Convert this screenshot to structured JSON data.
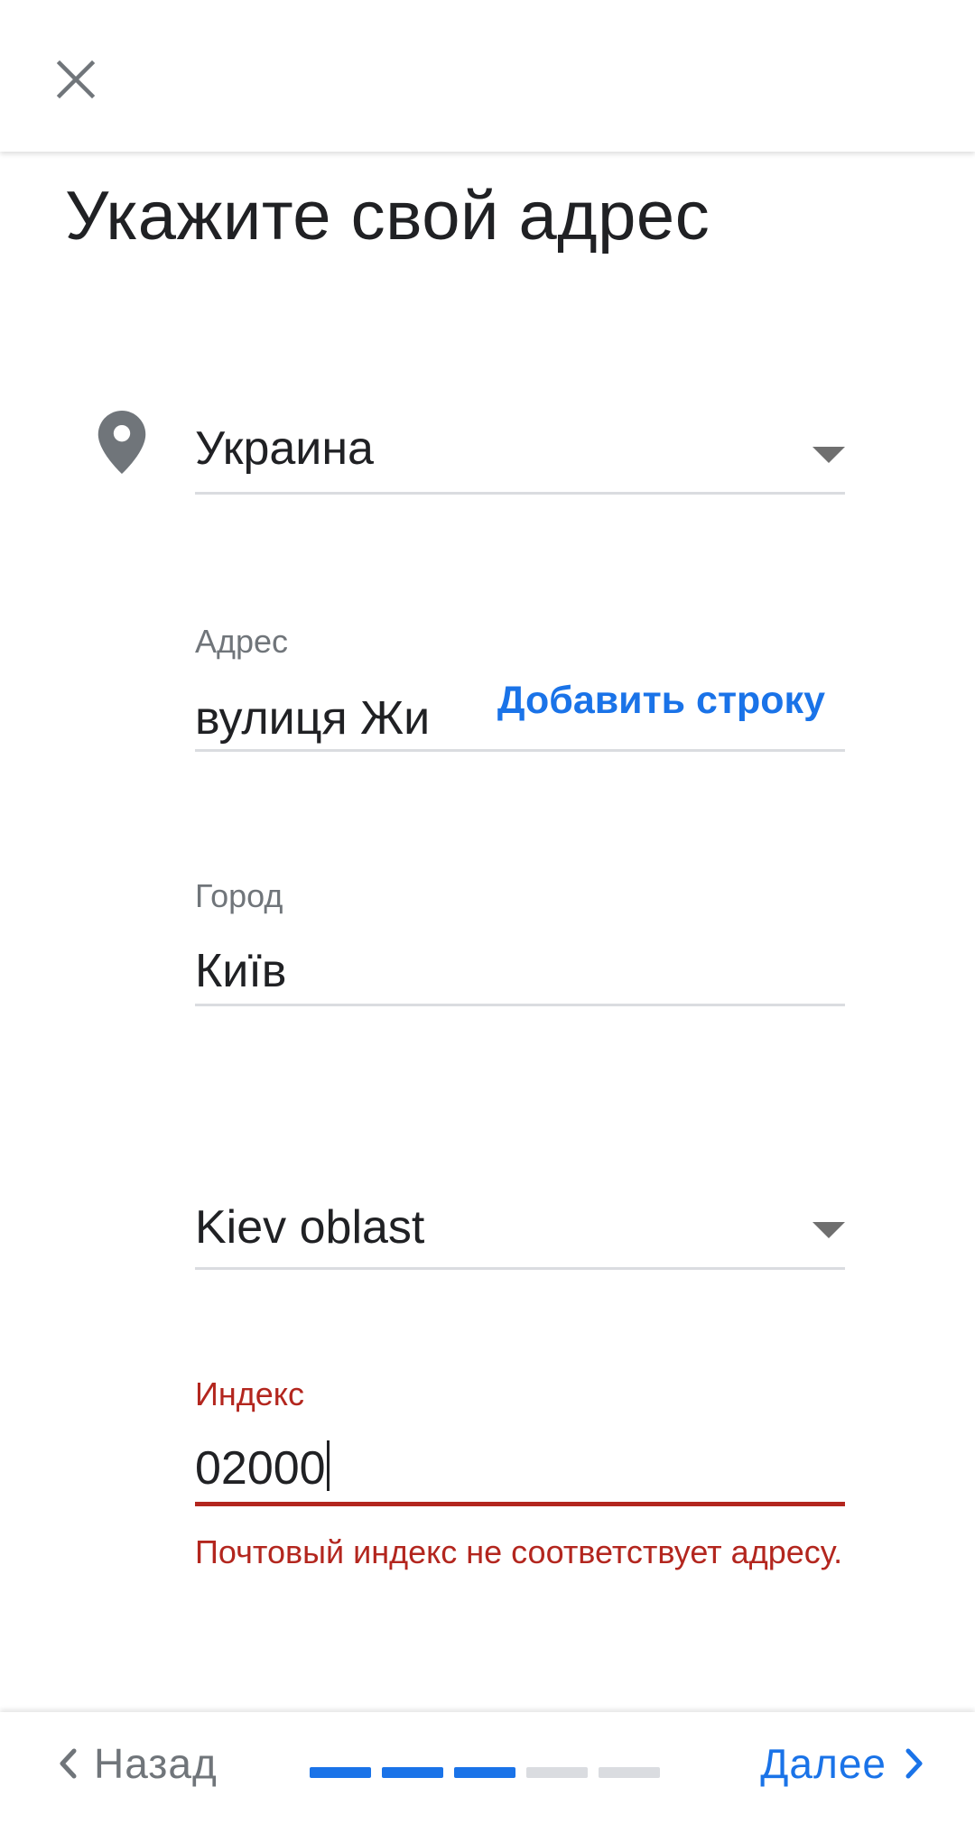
{
  "header": {
    "close_icon": "close-icon"
  },
  "page": {
    "title": "Укажите свой адрес"
  },
  "form": {
    "location_icon": "map-pin-icon",
    "country": {
      "value": "Украина",
      "icon": "chevron-down-icon"
    },
    "address": {
      "label": "Адрес",
      "value": "вулиця Жи",
      "add_line_label": "Добавить строку"
    },
    "city": {
      "label": "Город",
      "value": "Київ"
    },
    "region": {
      "value": "Kiev oblast",
      "icon": "chevron-down-icon"
    },
    "postal": {
      "label": "Индекс",
      "value": "02000",
      "error": "Почтовый индекс не соответствует адресу."
    }
  },
  "footer": {
    "back_label": "Назад",
    "next_label": "Далее",
    "progress": {
      "total_steps": 5,
      "completed_steps": 3
    }
  },
  "colors": {
    "accent": "#1a73e8",
    "error": "#b3261e",
    "progress_inactive": "#dadce0",
    "icon_gray": "#70757a"
  }
}
